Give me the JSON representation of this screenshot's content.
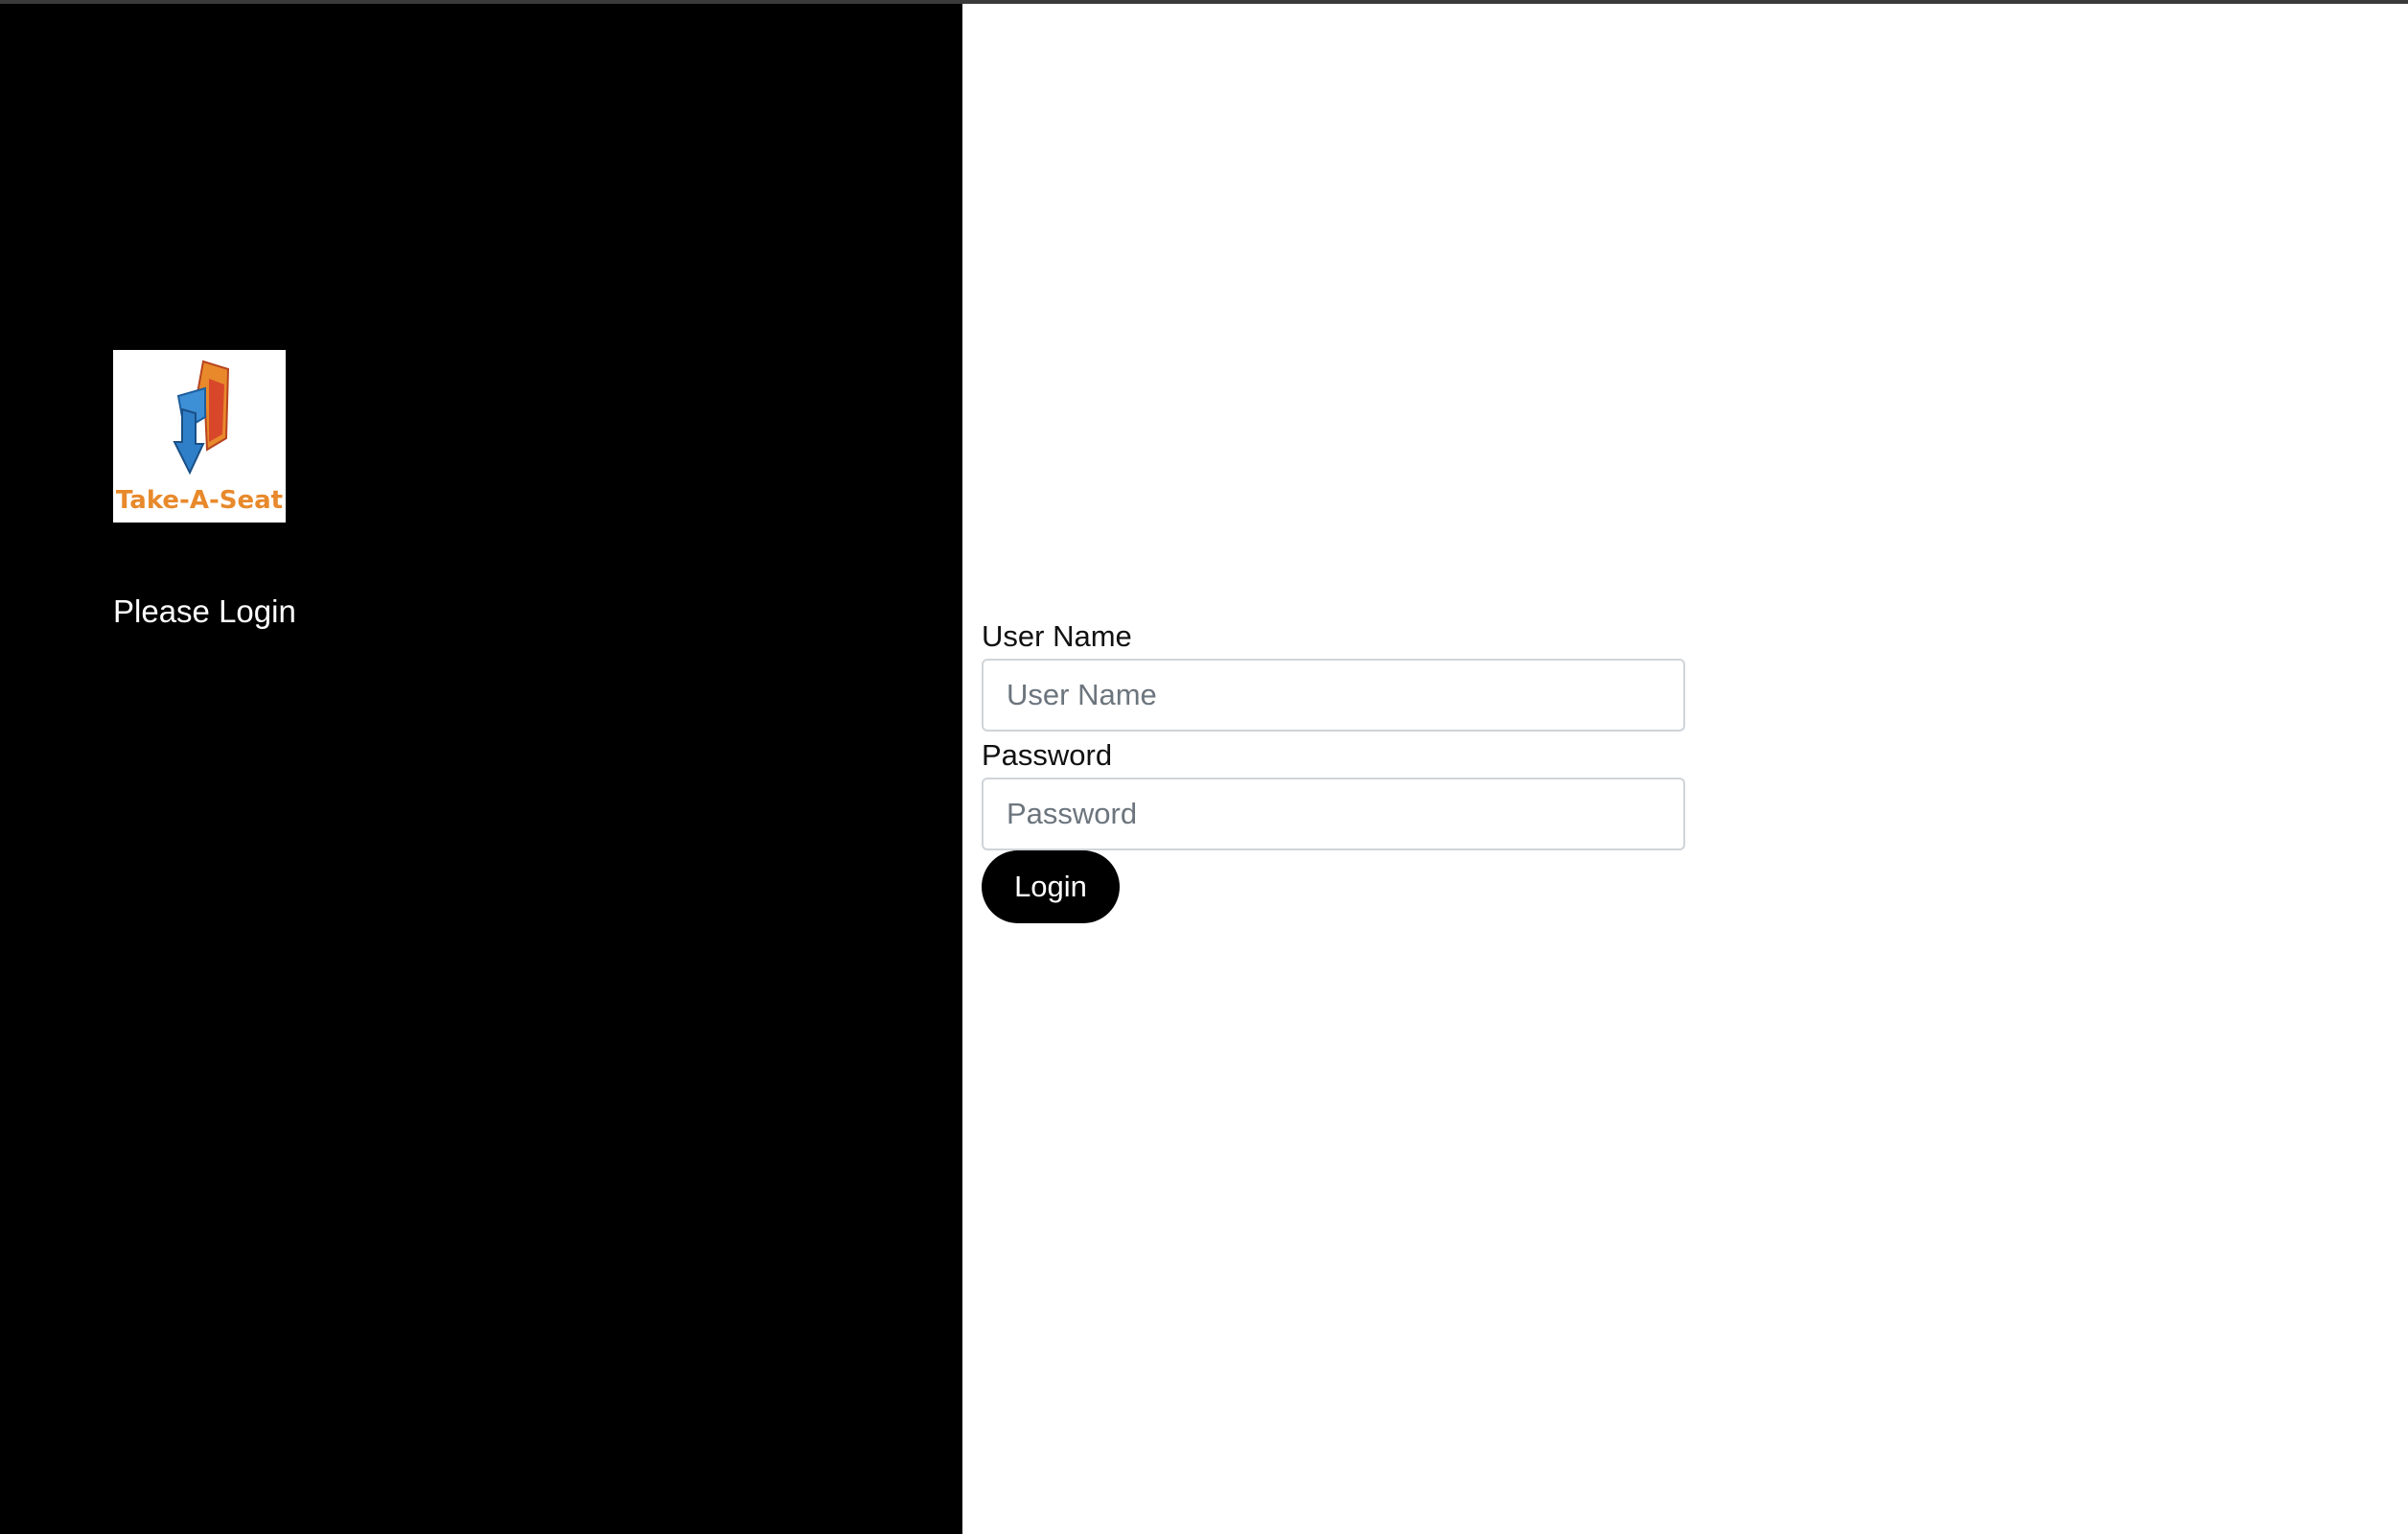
{
  "brand": {
    "logo_text": "Take-A-Seat",
    "logo_icon": "chair-arrow-icon"
  },
  "sidebar": {
    "prompt": "Please Login"
  },
  "form": {
    "username_label": "User Name",
    "username_placeholder": "User Name",
    "username_value": "",
    "password_label": "Password",
    "password_placeholder": "Password",
    "password_value": "",
    "submit_label": "Login"
  },
  "colors": {
    "sidebar_bg": "#000000",
    "button_bg": "#000000",
    "logo_orange": "#e8892b",
    "logo_blue": "#3d8fd6",
    "logo_red": "#d9472b"
  }
}
